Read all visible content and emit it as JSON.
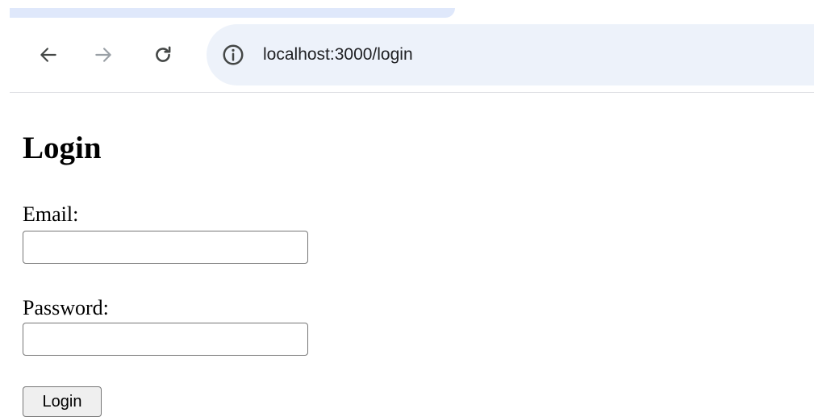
{
  "browser": {
    "url": "localhost:3000/login",
    "icons": {
      "back": "arrow-left-icon",
      "forward": "arrow-right-icon",
      "reload": "reload-icon",
      "site_info": "info-icon"
    }
  },
  "page": {
    "title": "Login",
    "email": {
      "label": "Email:",
      "value": "",
      "placeholder": ""
    },
    "password": {
      "label": "Password:",
      "value": "",
      "placeholder": ""
    },
    "submit_label": "Login"
  },
  "colors": {
    "omnibox_bg": "#edf2fa",
    "tab_strip": "#dfe8fb",
    "icon": "#444746"
  }
}
